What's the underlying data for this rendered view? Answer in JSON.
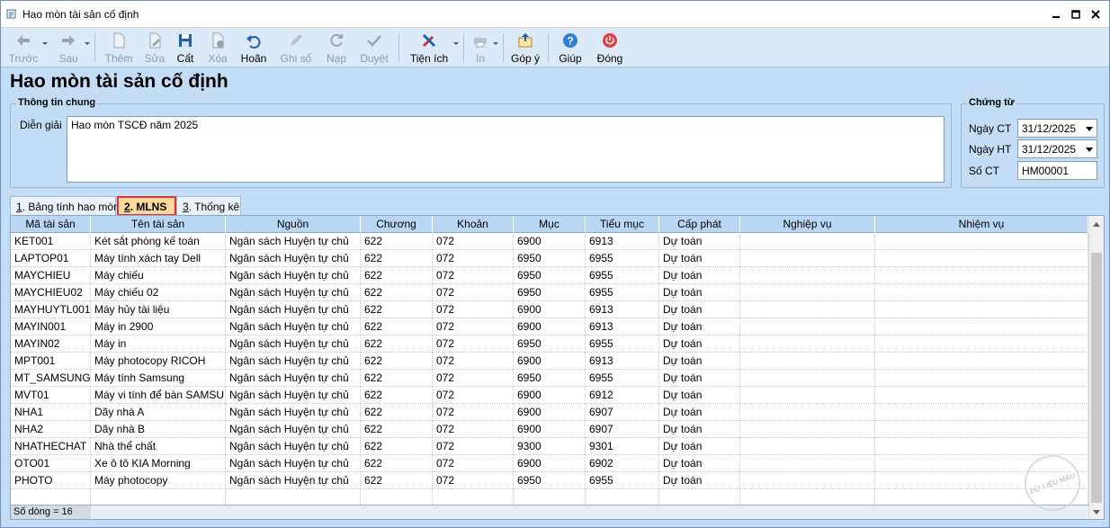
{
  "window": {
    "title": "Hao mòn tài sản cố định"
  },
  "toolbar": {
    "items": [
      {
        "label": "Trước"
      },
      {
        "label": "Sau"
      },
      {
        "label": "Thêm"
      },
      {
        "label": "Sửa"
      },
      {
        "label": "Cất"
      },
      {
        "label": "Xóa"
      },
      {
        "label": "Hoãn"
      },
      {
        "label": "Ghi sổ"
      },
      {
        "label": "Nạp"
      },
      {
        "label": "Duyệt"
      },
      {
        "label": "Tiện ích"
      },
      {
        "label": "In"
      },
      {
        "label": "Góp ý"
      },
      {
        "label": "Giúp"
      },
      {
        "label": "Đóng"
      }
    ]
  },
  "page": {
    "title": "Hao mòn tài sản cố định"
  },
  "general": {
    "legend": "Thông tin chung",
    "description_label": "Diễn giải",
    "description_value": "Hao mòn TSCĐ năm 2025"
  },
  "voucher": {
    "legend": "Chứng từ",
    "date_ct_label": "Ngày CT",
    "date_ct_value": "31/12/2025",
    "date_ht_label": "Ngày HT",
    "date_ht_value": "31/12/2025",
    "number_label": "Số CT",
    "number_value": "HM00001"
  },
  "tabs": [
    {
      "num": "1",
      "label": ". Bảng tính hao mòn"
    },
    {
      "num": "2",
      "label": ". MLNS"
    },
    {
      "num": "3",
      "label": ". Thống kê"
    }
  ],
  "grid": {
    "columns": [
      "Mã tài sản",
      "Tên tài sản",
      "Nguồn",
      "Chương",
      "Khoản",
      "Mục",
      "Tiểu mục",
      "Cấp phát",
      "Nghiệp vụ",
      "Nhiệm vụ"
    ],
    "rows": [
      [
        "KET001",
        "Két sắt phòng kế toán",
        "Ngân sách Huyện tự chủ",
        "622",
        "072",
        "6900",
        "6913",
        "Dự toán",
        "",
        ""
      ],
      [
        "LAPTOP01",
        "Máy tính xách tay Dell",
        "Ngân sách Huyện tự chủ",
        "622",
        "072",
        "6950",
        "6955",
        "Dự toán",
        "",
        ""
      ],
      [
        "MAYCHIEU",
        "Máy chiếu",
        "Ngân sách Huyện tự chủ",
        "622",
        "072",
        "6950",
        "6955",
        "Dự toán",
        "",
        ""
      ],
      [
        "MAYCHIEU02",
        "Máy chiếu 02",
        "Ngân sách Huyện tự chủ",
        "622",
        "072",
        "6950",
        "6955",
        "Dự toán",
        "",
        ""
      ],
      [
        "MAYHUYTL001",
        "Máy hủy tài liệu",
        "Ngân sách Huyện tự chủ",
        "622",
        "072",
        "6900",
        "6913",
        "Dự toán",
        "",
        ""
      ],
      [
        "MAYIN001",
        "Máy in 2900",
        "Ngân sách Huyện tự chủ",
        "622",
        "072",
        "6900",
        "6913",
        "Dự toán",
        "",
        ""
      ],
      [
        "MAYIN02",
        "Máy in",
        "Ngân sách Huyện tự chủ",
        "622",
        "072",
        "6950",
        "6955",
        "Dự toán",
        "",
        ""
      ],
      [
        "MPT001",
        "Máy photocopy RICOH",
        "Ngân sách Huyện tự chủ",
        "622",
        "072",
        "6900",
        "6913",
        "Dự toán",
        "",
        ""
      ],
      [
        "MT_SAMSUNG",
        "Máy tính Samsung",
        "Ngân sách Huyện tự chủ",
        "622",
        "072",
        "6950",
        "6955",
        "Dự toán",
        "",
        ""
      ],
      [
        "MVT01",
        "Máy vi tính để bàn SAMSU...",
        "Ngân sách Huyện tự chủ",
        "622",
        "072",
        "6900",
        "6912",
        "Dự toán",
        "",
        ""
      ],
      [
        "NHA1",
        "Dãy nhà A",
        "Ngân sách Huyện tự chủ",
        "622",
        "072",
        "6900",
        "6907",
        "Dự toán",
        "",
        ""
      ],
      [
        "NHA2",
        "Dãy nhà B",
        "Ngân sách Huyện tự chủ",
        "622",
        "072",
        "6900",
        "6907",
        "Dự toán",
        "",
        ""
      ],
      [
        "NHATHECHAT",
        "Nhà thể chất",
        "Ngân sách Huyện tự chủ",
        "622",
        "072",
        "9300",
        "9301",
        "Dự toán",
        "",
        ""
      ],
      [
        "OTO01",
        "Xe ô tô KIA Morning",
        "Ngân sách Huyện tự chủ",
        "622",
        "072",
        "6900",
        "6902",
        "Dự toán",
        "",
        ""
      ],
      [
        "PHOTO",
        "Máy photocopy",
        "Ngân sách Huyện tự chủ",
        "622",
        "072",
        "6950",
        "6955",
        "Dự toán",
        "",
        ""
      ]
    ],
    "footer": "Số dòng = 16"
  },
  "watermark": "DỮ LIỆU MẪU",
  "colors": {
    "accent": "#e0343c",
    "header": "#b9d6f5",
    "background": "#c4ddf6"
  }
}
